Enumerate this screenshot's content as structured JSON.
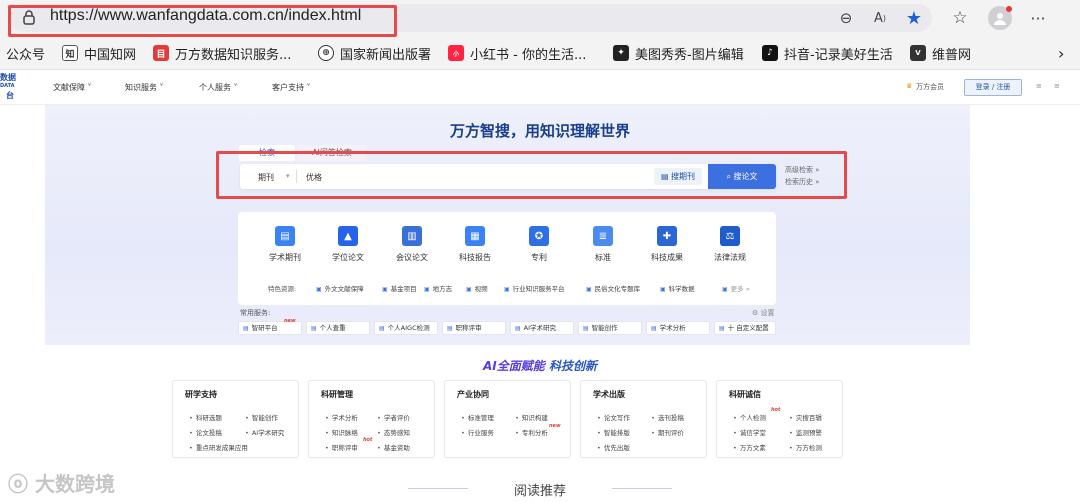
{
  "browser": {
    "url": "https://www.wanfangdata.com.cn/index.html",
    "bookmarks": [
      "公众号",
      "中国知网",
      "万方数据知识服务...",
      "国家新闻出版署",
      "小红书 - 你的生活...",
      "美图秀秀-图片编辑",
      "抖音-记录美好生活",
      "维普网"
    ],
    "annotation_color": "#e64a4a"
  },
  "header": {
    "logo": [
      "数据",
      "DATA",
      "台"
    ],
    "nav": [
      "文献保障 ˅",
      "知识服务 ˅",
      "个人服务 ˅",
      "客户支持 ˅"
    ],
    "member": "万方会员",
    "login": "登录 / 注册",
    "extra": [
      "≡",
      "≡"
    ]
  },
  "hero": {
    "title": "万方智搜，用知识理解世界",
    "tabs": [
      "检索",
      "AI问答检索"
    ],
    "search": {
      "type": "期刊",
      "query": "优格",
      "journal_button": "搜期刊",
      "search_button": "搜论文",
      "advanced": "高级检索 »",
      "history": "检索历史 »"
    }
  },
  "resources": {
    "items": [
      "学术期刊",
      "学位论文",
      "会议论文",
      "科技报告",
      "专利",
      "标准",
      "科技成果",
      "法律法规"
    ],
    "featured_label": "特色资源:",
    "featured": [
      "外文文献保障",
      "基金项目",
      "地方志",
      "视频",
      "行业知识服务平台",
      "民俗文化专题库",
      "科学数据",
      "更多 »"
    ],
    "common_label": "常用服务:",
    "settings": "⚙ 设置",
    "services": [
      "智研平台",
      "个人查重",
      "个人AIGC检测",
      "职称评审",
      "AI学术研究",
      "智能创作",
      "学术分析",
      "十 自定义配置"
    ],
    "new_tag": "new"
  },
  "ai_section": {
    "title_a": "AI全面赋能",
    "title_b": "科技创新",
    "cards": [
      {
        "title": "研学支持",
        "items": [
          "科研选题",
          "智能创作",
          "论文投稿",
          "AI学术研究",
          "重点研发成果应用"
        ]
      },
      {
        "title": "科研管理",
        "items": [
          "学术分析",
          "学者评价",
          "知识脉络",
          "态势感知",
          "职称评审",
          "基金资助"
        ]
      },
      {
        "title": "产业协同",
        "items": [
          "标准管理",
          "知识构建",
          "行业服务",
          "专利分析"
        ]
      },
      {
        "title": "学术出版",
        "items": [
          "论文写作",
          "选刊投稿",
          "智能排版",
          "期刊评价",
          "优先出版"
        ]
      },
      {
        "title": "科研诚信",
        "items": [
          "个人检测",
          "灾搜百辑",
          "诚信学堂",
          "监测预警",
          "万方文素",
          "万方检测"
        ]
      }
    ],
    "hot_tag": "hot",
    "new_tag": "new"
  },
  "reading": "阅读推荐",
  "watermark": "大数跨境"
}
